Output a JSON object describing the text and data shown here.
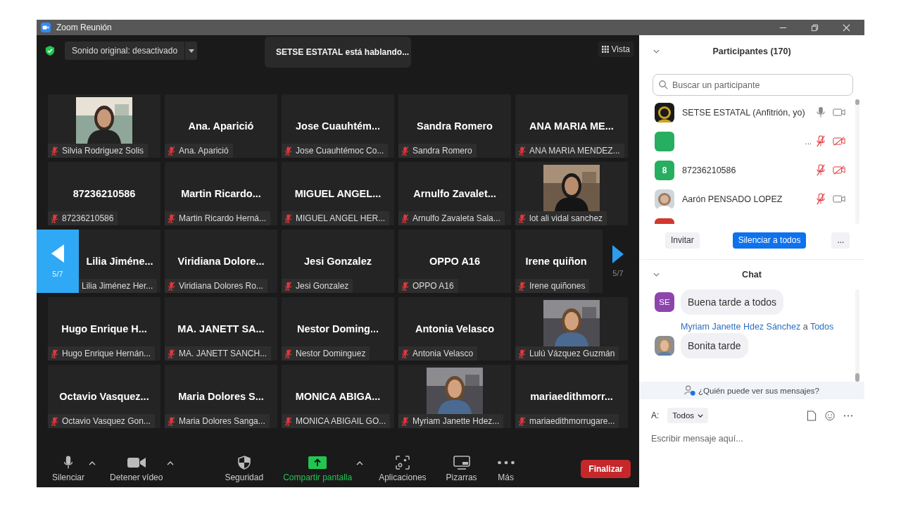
{
  "window": {
    "title": "Zoom Reunión"
  },
  "top_bar": {
    "audio_dropdown": "Sonido original: desactivado",
    "speaker_banner": "SETSE ESTATAL está hablando...",
    "view_button": "Vista"
  },
  "gallery": {
    "page_left": "5/7",
    "page_right": "5/7",
    "tiles": [
      {
        "kind": "picture",
        "label": "Silvia Rodriguez Solis",
        "muted": true
      },
      {
        "kind": "name",
        "title": "Ana. Aparició",
        "label": "Ana. Aparició",
        "muted": true
      },
      {
        "kind": "name",
        "title": "Jose Cuauhtém...",
        "label": "Jose Cuauhtémoc Co...",
        "muted": true
      },
      {
        "kind": "name",
        "title": "Sandra Romero",
        "label": "Sandra Romero",
        "muted": true
      },
      {
        "kind": "name",
        "title": "ANA MARIA ME...",
        "label": "ANA MARIA MENDEZ...",
        "muted": true
      },
      {
        "kind": "name",
        "title": "87236210586",
        "label": "87236210586",
        "muted": true
      },
      {
        "kind": "name",
        "title": "Martin Ricardo...",
        "label": "Martin Ricardo Herná...",
        "muted": true
      },
      {
        "kind": "name",
        "title": "MIGUEL ANGEL...",
        "label": "MIGUEL ANGEL HER...",
        "muted": true
      },
      {
        "kind": "name",
        "title": "Arnulfo Zavalet...",
        "label": "Arnulfo Zavaleta Sala...",
        "muted": true
      },
      {
        "kind": "picture",
        "label": "lot ali vidal sanchez",
        "muted": true
      },
      {
        "kind": "name",
        "title": "Lilia Jiméne...",
        "label": "Lilia Jiménez Her...",
        "muted": false
      },
      {
        "kind": "name",
        "title": "Viridiana Dolore...",
        "label": "Viridiana Dolores Ro...",
        "muted": true
      },
      {
        "kind": "name",
        "title": "Jesi Gonzalez",
        "label": "Jesi Gonzalez",
        "muted": true
      },
      {
        "kind": "name",
        "title": "OPPO A16",
        "label": "OPPO A16",
        "muted": true
      },
      {
        "kind": "name",
        "title": "Irene quiñon",
        "label": "Irene quiñones",
        "muted": true
      },
      {
        "kind": "name",
        "title": "Hugo Enrique H...",
        "label": "Hugo Enrique Hernán...",
        "muted": true
      },
      {
        "kind": "name",
        "title": "MA. JANETT SA...",
        "label": "MA. JANETT SANCH...",
        "muted": true
      },
      {
        "kind": "name",
        "title": "Nestor Doming...",
        "label": "Nestor Dominguez",
        "muted": true
      },
      {
        "kind": "name",
        "title": "Antonia Velasco",
        "label": "Antonia Velasco",
        "muted": true
      },
      {
        "kind": "picture",
        "label": "Lulú Vázquez Guzmán",
        "muted": true
      },
      {
        "kind": "name",
        "title": "Octavio Vasquez...",
        "label": "Octavio Vasquez Gon...",
        "muted": true
      },
      {
        "kind": "name",
        "title": "Maria Dolores S...",
        "label": "Maria Dolores Sanga...",
        "muted": true
      },
      {
        "kind": "name",
        "title": "MONICA ABIGA...",
        "label": "MONICA ABIGAIL GO...",
        "muted": true
      },
      {
        "kind": "picture",
        "label": "Myriam Janette Hdez...",
        "muted": true
      },
      {
        "kind": "name",
        "title": "mariaedithmorr...",
        "label": "mariaedithmorrugare...",
        "muted": true
      }
    ]
  },
  "participants": {
    "title": "Participantes (170)",
    "search": {
      "placeholder": "Buscar un participante"
    },
    "rows": [
      {
        "name": "SETSE ESTATAL (Anfitrión, yo)",
        "muted": false,
        "video_off": false
      },
      {
        "avatar": {
          "kind": "color",
          "color": "#27ae60"
        },
        "more": "...",
        "muted": true,
        "video_off": true
      },
      {
        "avatar": {
          "kind": "color",
          "color": "#27ae60",
          "text": "8"
        },
        "name": "87236210586",
        "muted": true,
        "video_off": true
      },
      {
        "name": "Aarón PENSADO LOPEZ",
        "muted": true,
        "video_off": false
      },
      {
        "avatar": {
          "kind": "color",
          "color": "#d0392b"
        }
      }
    ],
    "buttons": [
      {
        "label": "Invitar",
        "kind": "plain"
      },
      {
        "label": "Silenciar a todos",
        "kind": "primary"
      },
      {
        "label": "...",
        "kind": "plain"
      }
    ]
  },
  "chat": {
    "title": "Chat",
    "messages": [
      {
        "avatar": {
          "kind": "initials",
          "text": "SE",
          "color": "#8e44ad"
        },
        "text": "Buena tarde a todos"
      },
      {
        "sender": "Myriam Janette Hdez Sánchez",
        "to_word": "a",
        "recipient": "Todos",
        "text": "Bonita tarde"
      }
    ],
    "notice": "¿Quién puede ver sus mensajes?",
    "to_label": "A:",
    "to_value": "Todos",
    "input": {
      "placeholder": "Escribir mensaje aquí..."
    }
  },
  "toolbar": [
    {
      "label": "Silenciar",
      "kind": "mic",
      "caret": true
    },
    {
      "label": "Detener vídeo",
      "kind": "camera",
      "caret": true
    },
    {
      "label": "Seguridad",
      "kind": "shield",
      "caret": false
    },
    {
      "label": "Compartir pantalla",
      "kind": "share",
      "caret": true
    },
    {
      "label": "Aplicaciones",
      "kind": "apps",
      "caret": false
    },
    {
      "label": "Pizarras",
      "kind": "whiteboard",
      "caret": false
    },
    {
      "label": "Más",
      "kind": "more",
      "caret": false
    }
  ],
  "end_button": "Finalizar"
}
